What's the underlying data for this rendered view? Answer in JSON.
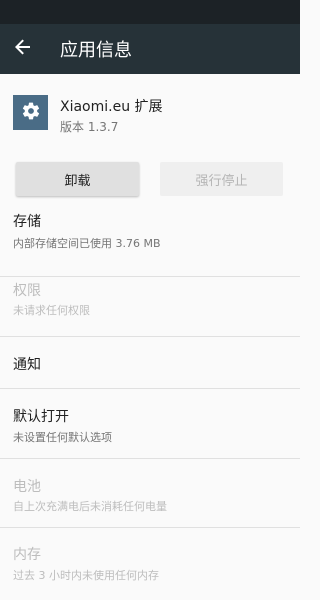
{
  "app_bar": {
    "title": "应用信息",
    "back_icon": "arrow-back-icon"
  },
  "app": {
    "name": "Xiaomi.eu 扩展",
    "version": "版本 1.3.7",
    "icon": "gear-icon",
    "icon_color": "#4a6c86"
  },
  "buttons": {
    "uninstall": "卸载",
    "force_stop": "强行停止"
  },
  "preferences": {
    "storage": {
      "title": "存储",
      "summary": "内部存储空间已使用 3.76 MB"
    },
    "permissions": {
      "title": "权限",
      "summary": "未请求任何权限"
    },
    "notifications": {
      "title": "通知"
    },
    "defaults": {
      "title": "默认打开",
      "summary": "未设置任何默认选项"
    },
    "battery": {
      "title": "电池",
      "summary": "自上次充满电后未消耗任何电量"
    },
    "memory": {
      "title": "内存",
      "summary": "过去 3 小时内未使用任何内存"
    }
  },
  "colors": {
    "status_bar": "#1c2226",
    "app_bar": "#263238",
    "background": "#fafafa"
  }
}
